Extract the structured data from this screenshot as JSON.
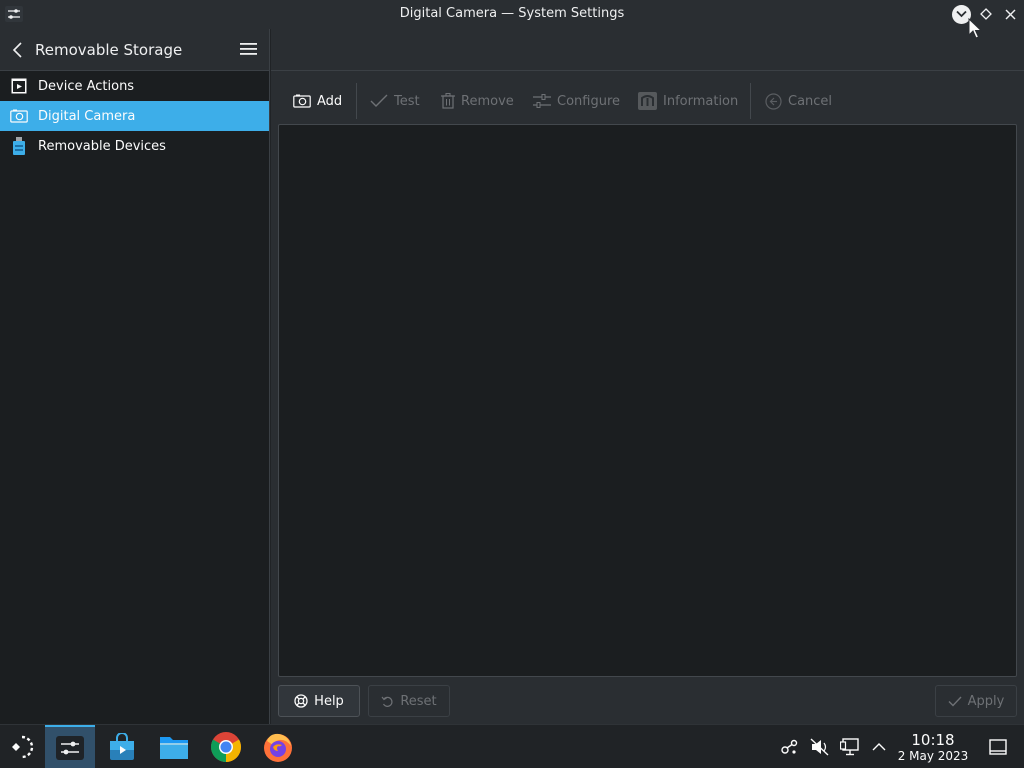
{
  "window": {
    "title": "Digital Camera — System Settings"
  },
  "sidebar": {
    "heading": "Removable Storage",
    "items": [
      {
        "label": "Device Actions",
        "icon": "device-actions-icon",
        "selected": false
      },
      {
        "label": "Digital Camera",
        "icon": "camera-icon",
        "selected": true
      },
      {
        "label": "Removable Devices",
        "icon": "usb-drive-icon",
        "selected": false
      }
    ]
  },
  "toolbar": {
    "add": "Add",
    "test": "Test",
    "remove": "Remove",
    "configure": "Configure",
    "information": "Information",
    "cancel": "Cancel"
  },
  "footer": {
    "help": "Help",
    "reset": "Reset",
    "apply": "Apply"
  },
  "taskbar": {
    "time": "10:18",
    "date": "2 May 2023"
  },
  "colors": {
    "accent": "#3daee9",
    "window_bg": "#2a2e32",
    "view_bg": "#1b1e20"
  }
}
